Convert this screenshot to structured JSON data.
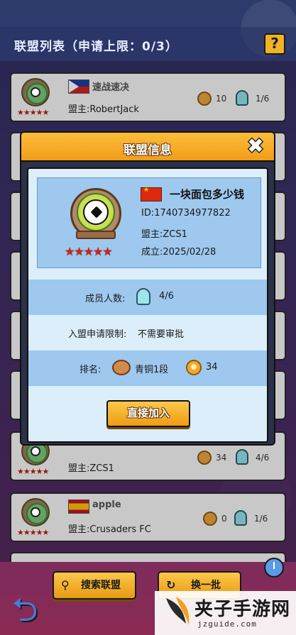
{
  "header": {
    "title": "联盟列表（申请上限：0/3）",
    "help_label": "?"
  },
  "list": [
    {
      "flag": "philippines",
      "name": "速战速决",
      "leader": "盟主:RobertJack",
      "stars": "★★★★★",
      "medal_count": "10",
      "members": "1/6"
    },
    {
      "flag": "china",
      "name": "",
      "leader": "盟主:ZCS1",
      "stars": "★★★★★",
      "medal_count": "34",
      "members": "4/6"
    },
    {
      "flag": "spain",
      "name": "apple",
      "leader": "盟主:Crusaders FC",
      "stars": "★★★★★",
      "medal_count": "0",
      "members": "1/6"
    }
  ],
  "bottom": {
    "search_label": "搜索联盟",
    "refresh_label": "换一批"
  },
  "modal": {
    "title": "联盟信息",
    "guild_name": "一块面包多少钱",
    "id_line": "ID:1740734977822",
    "leader_line": "盟主:ZCS1",
    "founded_line": "成立:2025/02/28",
    "stars": "★★★★★",
    "members_label": "成员人数:",
    "members_value": "4/6",
    "join_limit_label": "入盟申请限制:",
    "join_limit_value": "不需要审批",
    "rank_label": "排名:",
    "rank_tier": "青铜1段",
    "rank_points": "34",
    "join_button": "直接加入"
  },
  "watermark": {
    "title": "夹子手游网",
    "url": "jzguide.com"
  },
  "colors": {
    "accent_gold": "#f29d18",
    "modal_body": "#dbeefa",
    "row_highlight": "#9ec8ee",
    "star_red": "#d82010"
  },
  "icons": [
    "help-icon",
    "close-icon",
    "soccer-badge-icon",
    "medal-icon",
    "ghost-member-icon",
    "rank-bronze-icon",
    "search-icon",
    "refresh-icon",
    "back-arrow-icon",
    "clock-icon"
  ]
}
